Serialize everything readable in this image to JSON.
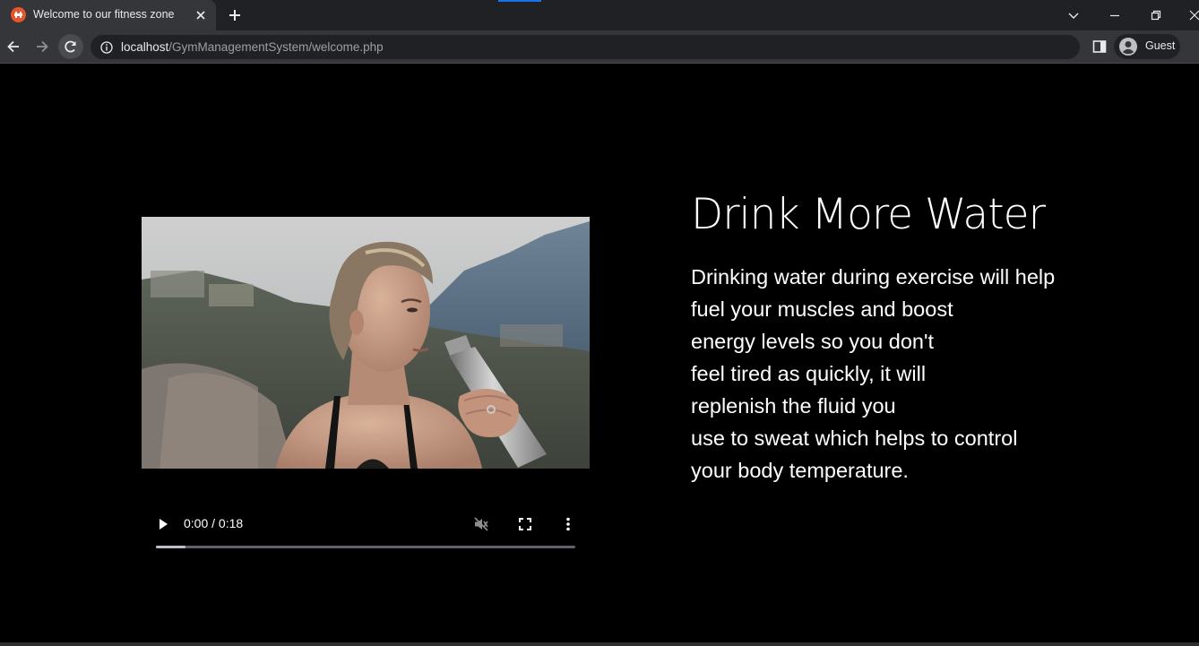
{
  "browser": {
    "tab": {
      "title": "Welcome to our fitness zone",
      "favicon": "dumbbell-favicon"
    },
    "address": {
      "host": "localhost",
      "path": "/GymManagementSystem/welcome.php"
    },
    "profile_label": "Guest",
    "icons": {
      "back": "arrow-left-icon",
      "forward": "arrow-right-icon",
      "reload": "reload-icon",
      "site_info": "info-icon",
      "side_panel": "side-panel-icon",
      "avatar": "person-icon",
      "tab_search": "chevron-down-icon",
      "minimize": "minimize-icon",
      "restore": "restore-icon",
      "close": "close-icon",
      "new_tab": "plus-icon"
    },
    "colors": {
      "tabstrip": "#202124",
      "toolbar": "#35363a",
      "accent": "#1a73e8"
    }
  },
  "page": {
    "background": "#000000",
    "video": {
      "time": "0:00 / 0:18",
      "buffered_fraction": 0.07,
      "muted": true,
      "icons": {
        "play": "play-icon",
        "mute": "volume-muted-icon",
        "fullscreen": "fullscreen-icon",
        "more": "more-vert-icon"
      }
    },
    "heading": "Drink More Water",
    "body_lines": [
      "Drinking water during exercise will help",
      "fuel your muscles and boost",
      "energy levels so you don't",
      "feel tired as quickly, it will",
      "replenish the fluid you",
      "use to sweat which helps to control",
      "your body temperature."
    ]
  }
}
